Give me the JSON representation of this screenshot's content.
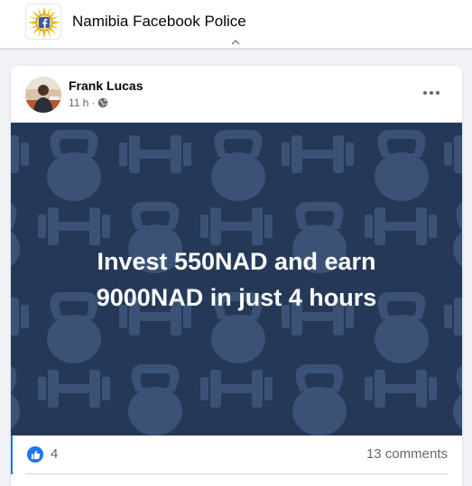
{
  "group": {
    "name": "Namibia Facebook Police",
    "logo_icon": "facebook-police-badge-icon"
  },
  "post": {
    "author": "Frank Lucas",
    "time": "11 h",
    "separator": "·",
    "privacy_icon": "globe-icon",
    "more_icon": "more-options-icon",
    "image": {
      "background": "#253858",
      "pattern_color": "#3b5276",
      "pattern_icons": [
        "dumbbell-icon",
        "kettlebell-icon"
      ],
      "text_line1": "Invest 550NAD and earn",
      "text_line2": "9000NAD in just 4 hours"
    },
    "reactions": {
      "like_icon": "like-icon",
      "count": "4",
      "comments": "13 comments"
    }
  },
  "colors": {
    "accent": "#1877f2",
    "secondary_text": "#65676b"
  }
}
